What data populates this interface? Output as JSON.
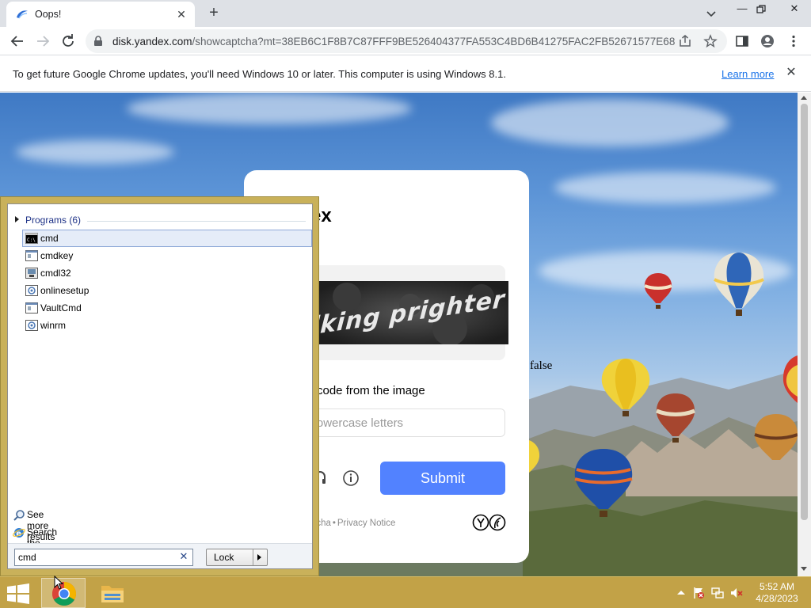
{
  "browser": {
    "tab_title": "Oops!",
    "url_host": "disk.yandex.com",
    "url_rest": "/showcaptcha?mt=38EB6C1F8B7C87FFF9BE526404377FA553C4BD6B41275FAC2FB52671577E68...",
    "infobar_text": "To get future Google Chrome updates, you'll need Windows 10 or later. This computer is using Windows 8.1.",
    "infobar_link": "Learn more"
  },
  "captcha": {
    "logo_text": "ex",
    "image_text": "lking prighter",
    "prompt": "code from the image",
    "input_placeholder": "se or lowercase letters",
    "submit_label": "Submit",
    "footer_left": "rtCaptcha",
    "footer_sep": "•",
    "footer_right": "Privacy Notice",
    "stray_text": "false"
  },
  "start_menu": {
    "group_label": "Programs (6)",
    "items": [
      {
        "label": "cmd",
        "icon": "console-icon",
        "selected": true
      },
      {
        "label": "cmdkey",
        "icon": "app-window-icon",
        "selected": false
      },
      {
        "label": "cmdl32",
        "icon": "network-app-icon",
        "selected": false
      },
      {
        "label": "onlinesetup",
        "icon": "setup-app-icon",
        "selected": false
      },
      {
        "label": "VaultCmd",
        "icon": "app-window-icon",
        "selected": false
      },
      {
        "label": "winrm",
        "icon": "setup-app-icon",
        "selected": false
      }
    ],
    "see_more": "See more results",
    "search_internet": "Search the Internet",
    "search_value": "cmd",
    "lock_label": "Lock"
  },
  "taskbar": {
    "time": "5:52 AM",
    "date": "4/28/2023",
    "apps": [
      "chrome-icon",
      "file-explorer-icon"
    ]
  },
  "colors": {
    "taskbar": "#c2a247",
    "submit": "#5282ff",
    "link": "#1a73e8"
  }
}
